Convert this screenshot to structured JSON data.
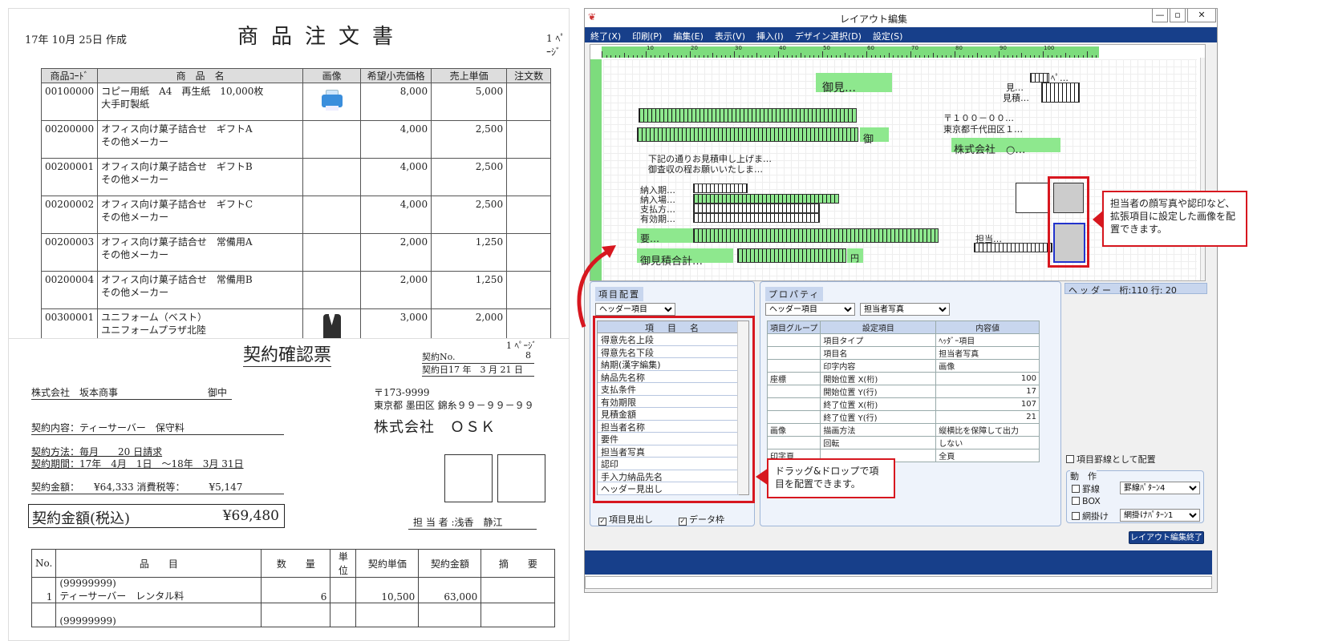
{
  "order_doc": {
    "date": "17年 10月 25日 作成",
    "title": "商品注文書",
    "page": "1 ﾍﾟｰｼﾞ",
    "headers": [
      "商品ｺｰﾄﾞ",
      "商　品　名",
      "画像",
      "希望小売価格",
      "売上単価",
      "注文数"
    ],
    "rows": [
      {
        "code": "00100000",
        "name1": "コピー用紙　A4　再生紙　10,000枚",
        "name2": "大手町製紙",
        "img": "printer",
        "price": "8,000",
        "unit": "5,000"
      },
      {
        "code": "00200000",
        "name1": "オフィス向け菓子詰合せ　ギフトA",
        "name2": "その他メーカー",
        "img": "",
        "price": "4,000",
        "unit": "2,500"
      },
      {
        "code": "00200001",
        "name1": "オフィス向け菓子詰合せ　ギフトB",
        "name2": "その他メーカー",
        "img": "",
        "price": "4,000",
        "unit": "2,500"
      },
      {
        "code": "00200002",
        "name1": "オフィス向け菓子詰合せ　ギフトC",
        "name2": "その他メーカー",
        "img": "",
        "price": "4,000",
        "unit": "2,500"
      },
      {
        "code": "00200003",
        "name1": "オフィス向け菓子詰合せ　常備用A",
        "name2": "その他メーカー",
        "img": "",
        "price": "2,000",
        "unit": "1,250"
      },
      {
        "code": "00200004",
        "name1": "オフィス向け菓子詰合せ　常備用B",
        "name2": "その他メーカー",
        "img": "",
        "price": "2,000",
        "unit": "1,250"
      },
      {
        "code": "00300001",
        "name1": "ユニフォーム（ベスト）",
        "name2": "ユニフォームプラザ北陸",
        "img": "vest",
        "price": "3,000",
        "unit": "2,000"
      }
    ]
  },
  "contract_doc": {
    "title": "契約確認票",
    "page": "1 ﾍﾟｰｼﾞ",
    "no_label": "契約No.",
    "no_value": "8",
    "date": "契約日17 年　3 月 21 日",
    "customer": "株式会社　坂本商事",
    "honorific": "御中",
    "postal": "〒173-9999",
    "address": "東京都 墨田区 錦糸９９－９９－９９",
    "company": "株式会社　ＯＳＫ",
    "content": "契約内容：ティーサーバー　保守料",
    "method": "契約方法：毎月　　20 日請求",
    "period": "契約期間：17年　4月　1日　～18年　3月 31日",
    "amount_line": "契約金額：　　¥64,333 消費税等：　　　¥5,147",
    "total_label": "契約金額(税込)",
    "total_value": "¥69,480",
    "person": "担 当 者 :浅香　静江",
    "headers": [
      "No.",
      "品　　目",
      "数　　量",
      "単位",
      "契約単価",
      "契約金額",
      "摘　　要"
    ],
    "rows": [
      {
        "no": "1",
        "item1": "(99999999)",
        "item2": "ティーサーバー　レンタル料",
        "qty": "6",
        "unit": "",
        "price": "10,500",
        "amount": "63,000"
      },
      {
        "no": "",
        "item1": "(99999999)",
        "item2": "",
        "qty": "",
        "unit": "",
        "price": "",
        "amount": ""
      }
    ]
  },
  "app": {
    "title": "レイアウト編集",
    "menu": [
      "終了(X)",
      "印刷(P)",
      "編集(E)",
      "表示(V)",
      "挿入(I)",
      "デザイン選択(D)",
      "設定(S)"
    ],
    "ruler_marks": [
      "10",
      "20",
      "30",
      "40",
      "50",
      "60",
      "70",
      "80",
      "90",
      "100"
    ],
    "canvas_labels": {
      "title": "御見…",
      "mitsumori": "見…",
      "mitsumori2": "見積…",
      "page": "ﾍﾟ…",
      "postal": "〒１００－００…",
      "address": "東京都千代田区１…",
      "company": "株式会社　○…",
      "onchu": "御",
      "greet1": "下記の通りお見積申し上げま…",
      "greet2": "御査収の程お願いいたしま…",
      "nouki": "納入期…",
      "nyuba": "納入場…",
      "shiharai": "支払方…",
      "yuko": "有効期…",
      "yoken": "要…",
      "total": "御見積合計…",
      "yen": "円",
      "tanto": "担当…"
    },
    "layout_panel": {
      "title": "項目配置",
      "group": "ヘッダー項目",
      "list_header": "項　目　名",
      "items": [
        "得意先名上段",
        "得意先名下段",
        "納期(漢字編集)",
        "納品先名称",
        "支払条件",
        "有効期限",
        "見積金額",
        "担当者名称",
        "要件",
        "担当者写真",
        "認印",
        "手入力納品先名",
        "ヘッダー見出し"
      ],
      "check1": "項目見出し",
      "check2": "データ枠"
    },
    "prop_panel": {
      "title": "プロパティ",
      "select1": "ヘッダー項目",
      "select2": "担当者写真",
      "headers": [
        "項目グループ",
        "設定項目",
        "内容値"
      ],
      "rows": [
        {
          "group": "",
          "key": "項目タイプ",
          "val": "ﾍｯﾀﾞｰ項目",
          "align": "left"
        },
        {
          "group": "",
          "key": "項目名",
          "val": "担当者写真",
          "align": "left"
        },
        {
          "group": "",
          "key": "印字内容",
          "val": "画像",
          "align": "left"
        },
        {
          "group": "座標",
          "key": "開始位置 X(桁)",
          "val": "100",
          "align": "right"
        },
        {
          "group": "",
          "key": "開始位置 Y(行)",
          "val": "17",
          "align": "right"
        },
        {
          "group": "",
          "key": "終了位置 X(桁)",
          "val": "107",
          "align": "right"
        },
        {
          "group": "",
          "key": "終了位置 Y(行)",
          "val": "21",
          "align": "right"
        },
        {
          "group": "画像",
          "key": "描画方法",
          "val": "縦横比を保障して出力",
          "align": "left"
        },
        {
          "group": "",
          "key": "回転",
          "val": "しない",
          "align": "left"
        },
        {
          "group": "印字頁",
          "key": "",
          "val": "全頁",
          "align": "left"
        }
      ]
    },
    "status": {
      "section": "ヘッダー",
      "info": "桁:110 行: 20"
    },
    "right_panel": {
      "border_check": "項目罫線として配置",
      "action_title": "動　作",
      "ruled_line": "罫線",
      "ruled_select": "罫線ﾊﾟﾀｰﾝ4",
      "box": "BOX",
      "mesh": "網掛け",
      "mesh_select": "網掛けﾊﾟﾀｰﾝ1",
      "finish_button": "レイアウト編集終了"
    },
    "callouts": {
      "image": "担当者の顔写真や認印など、拡張項目に設定した画像を配置できます。",
      "drag": "ドラッグ&ドロップで項目を配置できます。"
    }
  }
}
